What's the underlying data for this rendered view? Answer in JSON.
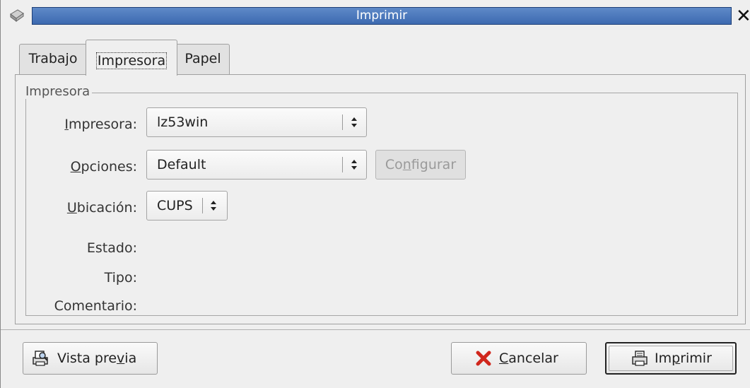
{
  "window": {
    "title": "Imprimir"
  },
  "tabs": [
    {
      "label": "Trabajo"
    },
    {
      "label": "Impresora",
      "selected": true
    },
    {
      "label": "Papel"
    }
  ],
  "printer_frame": {
    "legend": "Impresora",
    "fields": {
      "printer": {
        "label_pre": "",
        "label_mnemonic": "I",
        "label_post": "mpresora:",
        "value": "lz53win"
      },
      "options": {
        "label_pre": "",
        "label_mnemonic": "O",
        "label_post": "pciones:",
        "value": "Default"
      },
      "location": {
        "label_pre": "",
        "label_mnemonic": "U",
        "label_post": "bicación:",
        "value": "CUPS"
      },
      "status": {
        "label": "Estado:",
        "value": ""
      },
      "type": {
        "label": "Tipo:",
        "value": ""
      },
      "comment": {
        "label": "Comentario:",
        "value": ""
      }
    },
    "configure_button": {
      "pre": "Co",
      "mnemonic": "n",
      "post": "figurar",
      "enabled": false
    }
  },
  "buttons": {
    "preview": {
      "pre": "Vista pre",
      "mnemonic": "v",
      "post": "ia",
      "icon": "print-preview-icon"
    },
    "cancel": {
      "pre": "",
      "mnemonic": "C",
      "post": "ancelar",
      "icon": "cancel-x-icon"
    },
    "print": {
      "pre": "Im",
      "mnemonic": "p",
      "post": "rimir",
      "icon": "printer-icon",
      "default": true
    }
  },
  "colors": {
    "titlebar": "#3d6ab0",
    "window_bg": "#efefef",
    "cancel_icon": "#d0261c"
  }
}
